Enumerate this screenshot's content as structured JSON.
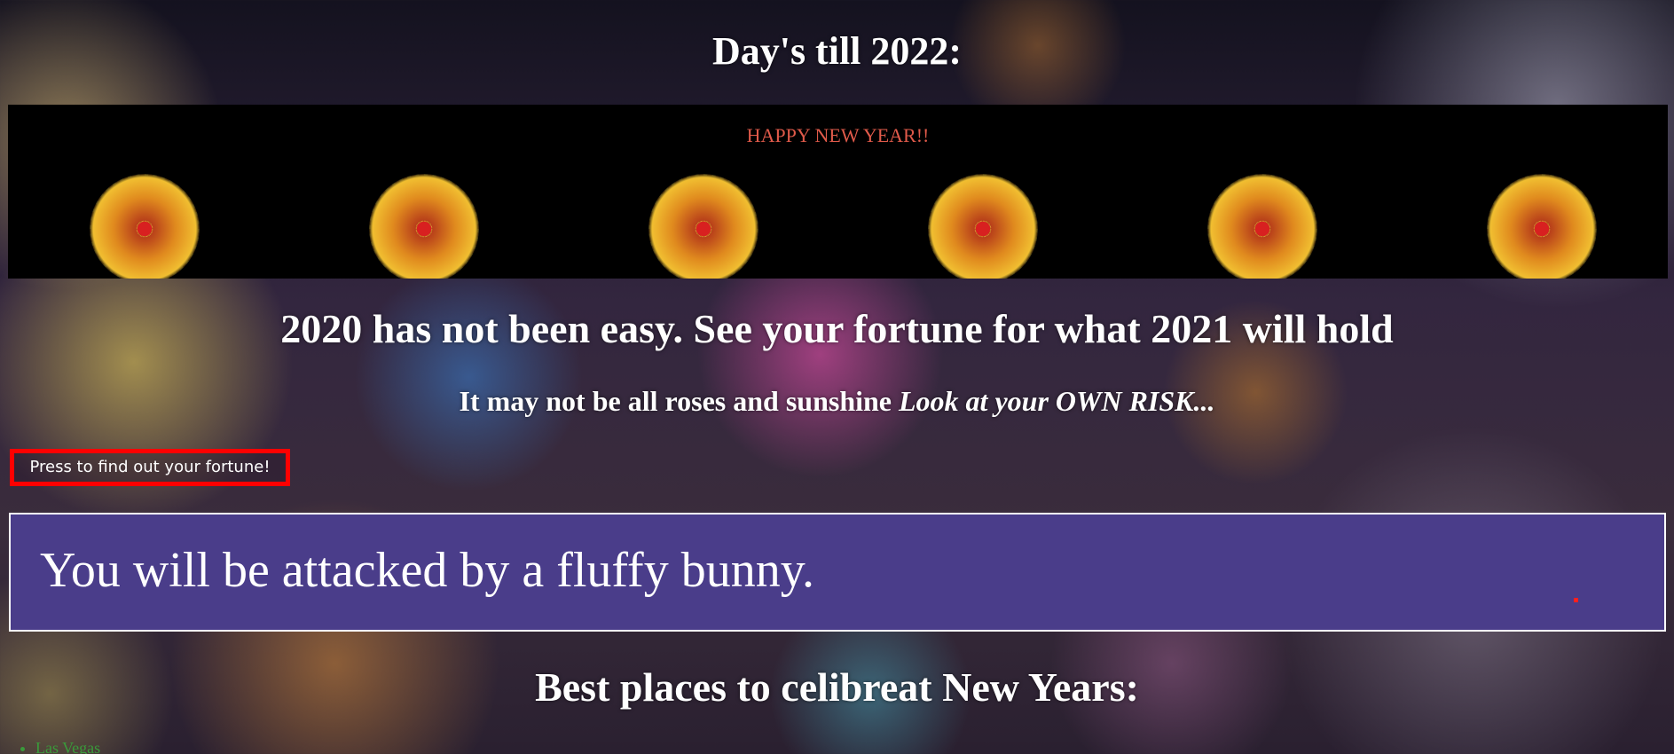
{
  "countdown_heading": "Day's till 2022:",
  "banner": {
    "message": "HAPPY NEW YEAR!!",
    "firework_count": 6
  },
  "subtitle": "2020 has not been easy. See your fortune for what 2021 will hold",
  "risk_line": {
    "plain": "It may not be all roses and sunshine ",
    "emphasis": "Look at your OWN RISK..."
  },
  "fortune_button_label": "Press to find out your fortune!",
  "fortune_text": "You will be attacked by a fluffy bunny.",
  "places_heading": "Best places to celibreat New Years:",
  "places": [
    "Las Vegas"
  ],
  "colors": {
    "banner_text": "#e05a4a",
    "button_border": "#ff0000",
    "fortune_box": "#4a3d8a",
    "list_text": "#3a9a3a"
  }
}
